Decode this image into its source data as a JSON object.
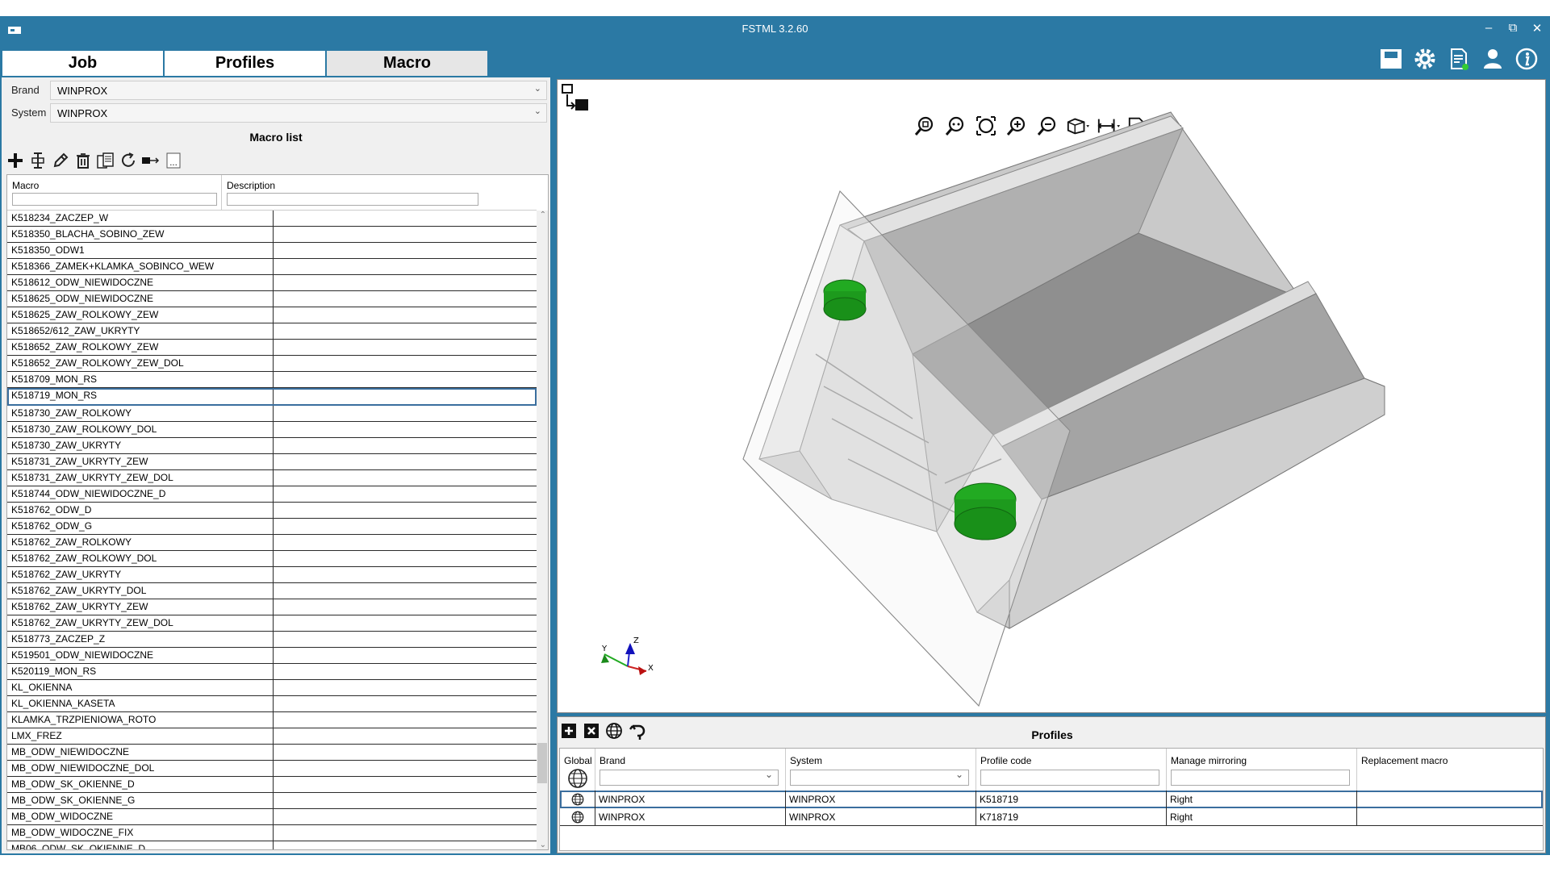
{
  "window": {
    "title": "FSTML 3.2.60",
    "controls": {
      "minimize": "–",
      "restore": "⧉",
      "close": "✕"
    }
  },
  "tabs": [
    {
      "label": "Job",
      "active": false
    },
    {
      "label": "Profiles",
      "active": false
    },
    {
      "label": "Macro",
      "active": true
    }
  ],
  "header_icons": [
    "save-icon",
    "settings-gear-icon",
    "report-document-icon",
    "user-icon",
    "info-icon"
  ],
  "left": {
    "brand_label": "Brand",
    "brand_value": "WINPROX",
    "system_label": "System",
    "system_value": "WINPROX",
    "macro_list_title": "Macro list",
    "toolbar_icons": [
      "add-icon",
      "insert-icon",
      "edit-pencil-icon",
      "delete-trash-icon",
      "copy-icon",
      "refresh-icon",
      "export-icon",
      "more-icon"
    ],
    "columns": {
      "macro": "Macro",
      "description": "Description"
    },
    "rows": [
      "K518234_ZACZEP_W",
      "K518350_BLACHA_SOBINO_ZEW",
      "K518350_ODW1",
      "K518366_ZAMEK+KLAMKA_SOBINCO_WEW",
      "K518612_ODW_NIEWIDOCZNE",
      "K518625_ODW_NIEWIDOCZNE",
      "K518625_ZAW_ROLKOWY_ZEW",
      "K518652/612_ZAW_UKRYTY",
      "K518652_ZAW_ROLKOWY_ZEW",
      "K518652_ZAW_ROLKOWY_ZEW_DOL",
      "K518709_MON_RS",
      "K518719_MON_RS",
      "K518730_ZAW_ROLKOWY",
      "K518730_ZAW_ROLKOWY_DOL",
      "K518730_ZAW_UKRYTY",
      "K518731_ZAW_UKRYTY_ZEW",
      "K518731_ZAW_UKRYTY_ZEW_DOL",
      "K518744_ODW_NIEWIDOCZNE_D",
      "K518762_ODW_D",
      "K518762_ODW_G",
      "K518762_ZAW_ROLKOWY",
      "K518762_ZAW_ROLKOWY_DOL",
      "K518762_ZAW_UKRYTY",
      "K518762_ZAW_UKRYTY_DOL",
      "K518762_ZAW_UKRYTY_ZEW",
      "K518762_ZAW_UKRYTY_ZEW_DOL",
      "K518773_ZACZEP_Z",
      "K519501_ODW_NIEWIDOCZNE",
      "K520119_MON_RS",
      "KL_OKIENNA",
      "KL_OKIENNA_KASETA",
      "KLAMKA_TRZPIENIOWA_ROTO",
      "LMX_FREZ",
      "MB_ODW_NIEWIDOCZNE",
      "MB_ODW_NIEWIDOCZNE_DOL",
      "MB_ODW_SK_OKIENNE_D",
      "MB_ODW_SK_OKIENNE_G",
      "MB_ODW_WIDOCZNE",
      "MB_ODW_WIDOCZNE_FIX",
      "MB06_ODW_SK_OKIENNE_D"
    ],
    "selected_row": "K518719_MON_RS"
  },
  "viewer": {
    "toolbar_icons": [
      "zoom-window-icon",
      "zoom-fit-icon",
      "zoom-extents-icon",
      "zoom-in-icon",
      "zoom-out-icon",
      "view-cube-icon",
      "measure-icon",
      "display-settings-icon",
      "render-mode-icon"
    ],
    "axes": {
      "x": "X",
      "y": "Y",
      "z": "Z"
    },
    "colors": {
      "profile": "#c8c8c8",
      "macro_highlight": "#22aa22",
      "plane": "#e0e0e0"
    }
  },
  "profiles": {
    "title": "Profiles",
    "toolbar_icons": [
      "add-profile-icon",
      "remove-profile-icon",
      "global-profile-icon",
      "undo-icon"
    ],
    "columns": {
      "global": "Global",
      "brand": "Brand",
      "system": "System",
      "profile_code": "Profile code",
      "manage_mirroring": "Manage mirroring",
      "replacement_macro": "Replacement macro"
    },
    "rows": [
      {
        "brand": "WINPROX",
        "system": "WINPROX",
        "profile_code": "K518719",
        "mirroring": "Right",
        "replacement": ""
      },
      {
        "brand": "WINPROX",
        "system": "WINPROX",
        "profile_code": "K718719",
        "mirroring": "Right",
        "replacement": ""
      }
    ]
  }
}
